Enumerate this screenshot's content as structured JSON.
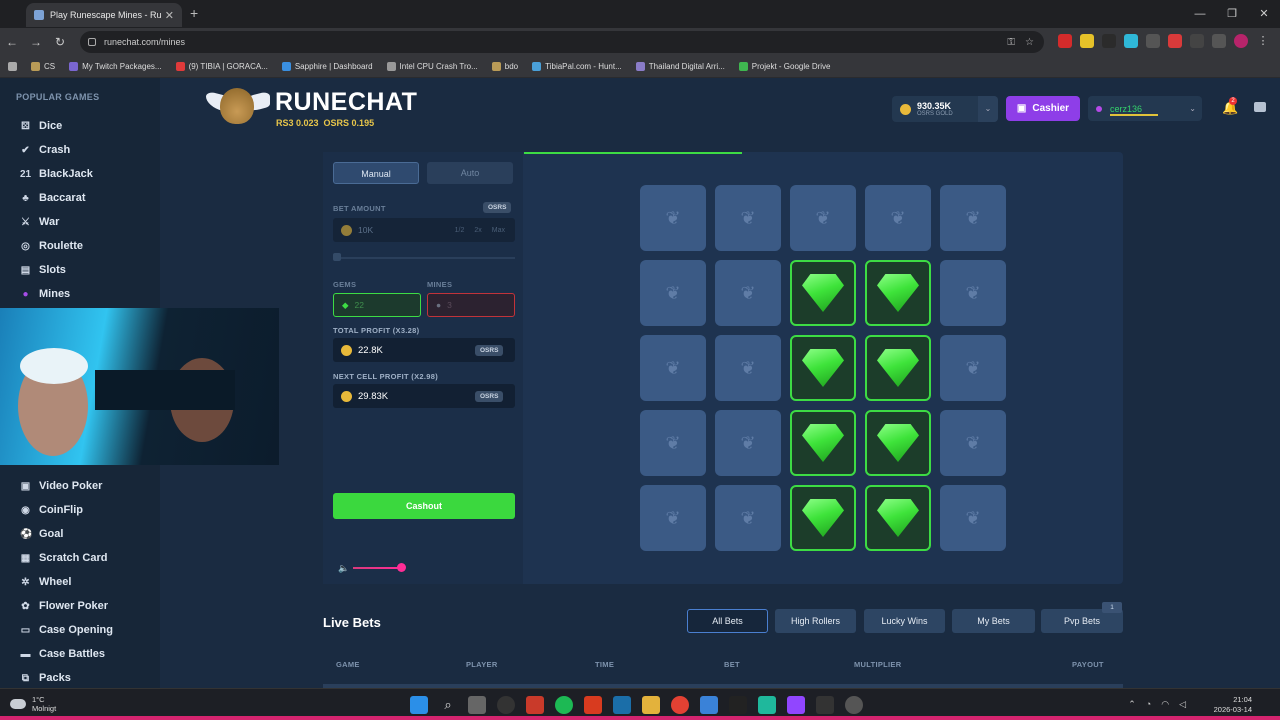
{
  "browser": {
    "tab_title": "Play Runescape Mines - Ru",
    "url": "runechat.com/mines",
    "bookmarks": [
      "CS",
      "My Twitch Packages...",
      "(9) TIBIA | GORACA...",
      "Sapphire | Dashboard",
      "Intel CPU Crash Tro...",
      "bdo",
      "TibiaPal.com - Hunt...",
      "Thailand Digital Arri...",
      "Projekt - Google Drive"
    ]
  },
  "sidebar": {
    "heading": "POPULAR GAMES",
    "items": [
      "Dice",
      "Crash",
      "BlackJack",
      "Baccarat",
      "War",
      "Roulette",
      "Slots",
      "Mines",
      "Video Poker",
      "CoinFlip",
      "Goal",
      "Scratch Card",
      "Wheel",
      "Flower Poker",
      "Case Opening",
      "Case Battles",
      "Packs"
    ]
  },
  "header": {
    "logo": "RUNECHAT",
    "rs3_rate": "RS3 0.023",
    "osrs_rate": "OSRS 0.195",
    "balance": "930.35K",
    "balance_currency": "OSRS GOLD",
    "cashier": "Cashier",
    "username": "cerz136",
    "notif_count": "2"
  },
  "controls": {
    "tab_manual": "Manual",
    "tab_auto": "Auto",
    "bet_label": "BET AMOUNT",
    "currency": "OSRS",
    "bet_value": "10K",
    "quick_half": "1/2",
    "quick_double": "2x",
    "quick_max": "Max",
    "gems_label": "GEMS",
    "mines_label": "MINES",
    "gems_value": "22",
    "mines_value": "3",
    "total_profit_label": "TOTAL PROFIT (X3.28)",
    "total_profit_value": "22.8K",
    "next_profit_label": "NEXT CELL PROFIT (X2.98)",
    "next_profit_value": "29.83K",
    "cashout": "Cashout"
  },
  "grid": {
    "rows": 5,
    "cols": 5,
    "revealed_gems": [
      [
        1,
        2
      ],
      [
        1,
        3
      ],
      [
        2,
        2
      ],
      [
        2,
        3
      ],
      [
        3,
        2
      ],
      [
        3,
        3
      ],
      [
        4,
        2
      ],
      [
        4,
        3
      ]
    ]
  },
  "live_bets": {
    "title": "Live Bets",
    "tabs": [
      "All Bets",
      "High Rollers",
      "Lucky Wins",
      "My Bets",
      "Pvp Bets"
    ],
    "active_tab": "All Bets",
    "pvp_badge": "1",
    "columns": [
      "GAME",
      "PLAYER",
      "TIME",
      "BET",
      "MULTIPLIER",
      "PAYOUT"
    ]
  },
  "taskbar": {
    "temp": "1°C",
    "weather": "Molnigt",
    "time": "21:04",
    "date": "2026-03-14"
  },
  "colors": {
    "accent_green": "#3ddc44",
    "cashier_purple": "#8e3ee8",
    "bg": "#1a2b41"
  }
}
